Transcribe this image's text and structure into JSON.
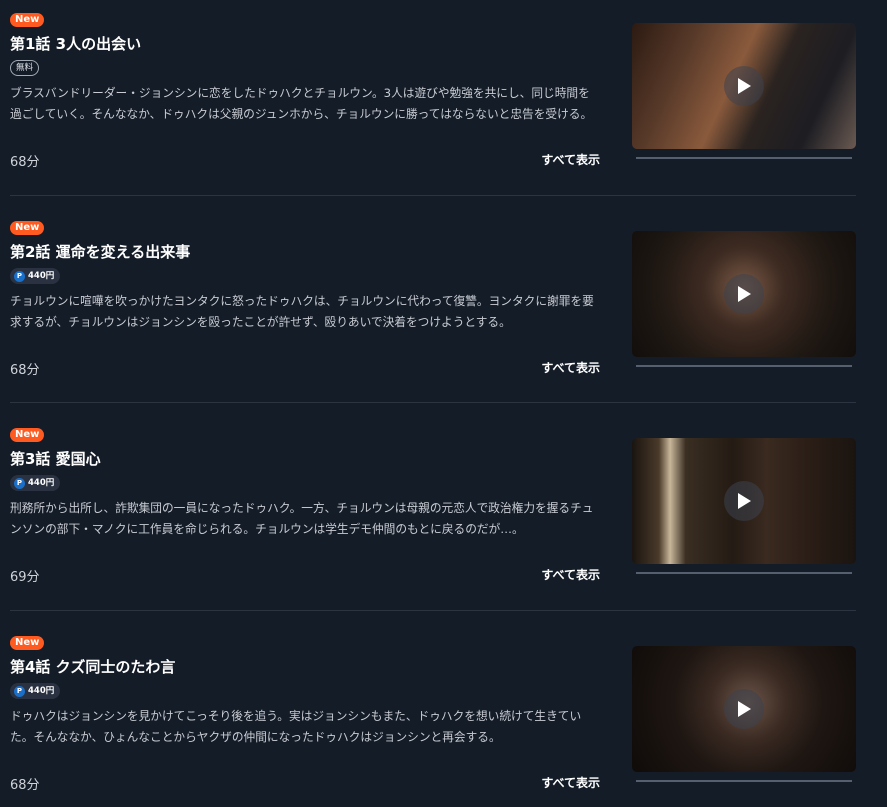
{
  "episodes": [
    {
      "badge": "New",
      "title": "第1話 3人の出会い",
      "price": "無料",
      "description": "ブラスバンドリーダー・ジョンシンに恋をしたドゥハクとチョルウン。3人は遊びや勉強を共にし、同じ時間を過ごしていく。そんななか、ドゥハクは父親のジュンホから、チョルウンに勝ってはならないと忠告を受ける。",
      "duration": "68分",
      "show_all": "すべて表示",
      "thumbnail_icon": "play-icon"
    },
    {
      "badge": "New",
      "title": "第2話 運命を変える出来事",
      "price": "440円",
      "price_icon": "P",
      "description": "チョルウンに喧嘩を吹っかけたヨンタクに怒ったドゥハクは、チョルウンに代わって復讐。ヨンタクに謝罪を要求するが、チョルウンはジョンシンを殴ったことが許せず、殴りあいで決着をつけようとする。",
      "duration": "68分",
      "show_all": "すべて表示",
      "thumbnail_icon": "play-icon"
    },
    {
      "badge": "New",
      "title": "第3話 愛国心",
      "price": "440円",
      "price_icon": "P",
      "description": "刑務所から出所し、詐欺集団の一員になったドゥハク。一方、チョルウンは母親の元恋人で政治権力を握るチュンソンの部下・マノクに工作員を命じられる。チョルウンは学生デモ仲間のもとに戻るのだが…。",
      "duration": "69分",
      "show_all": "すべて表示",
      "thumbnail_icon": "play-icon"
    },
    {
      "badge": "New",
      "title": "第4話 クズ同士のたわ言",
      "price": "440円",
      "price_icon": "P",
      "description": "ドゥハクはジョンシンを見かけてこっそり後を追う。実はジョンシンもまた、ドゥハクを想い続けて生きていた。そんななか、ひょんなことからヤクザの仲間になったドゥハクはジョンシンと再会する。",
      "duration": "68分",
      "show_all": "すべて表示",
      "thumbnail_icon": "play-icon"
    }
  ],
  "colors": {
    "background": "#141c28",
    "new_badge": "#ff5a1f",
    "point_icon": "#1a6fc9"
  }
}
